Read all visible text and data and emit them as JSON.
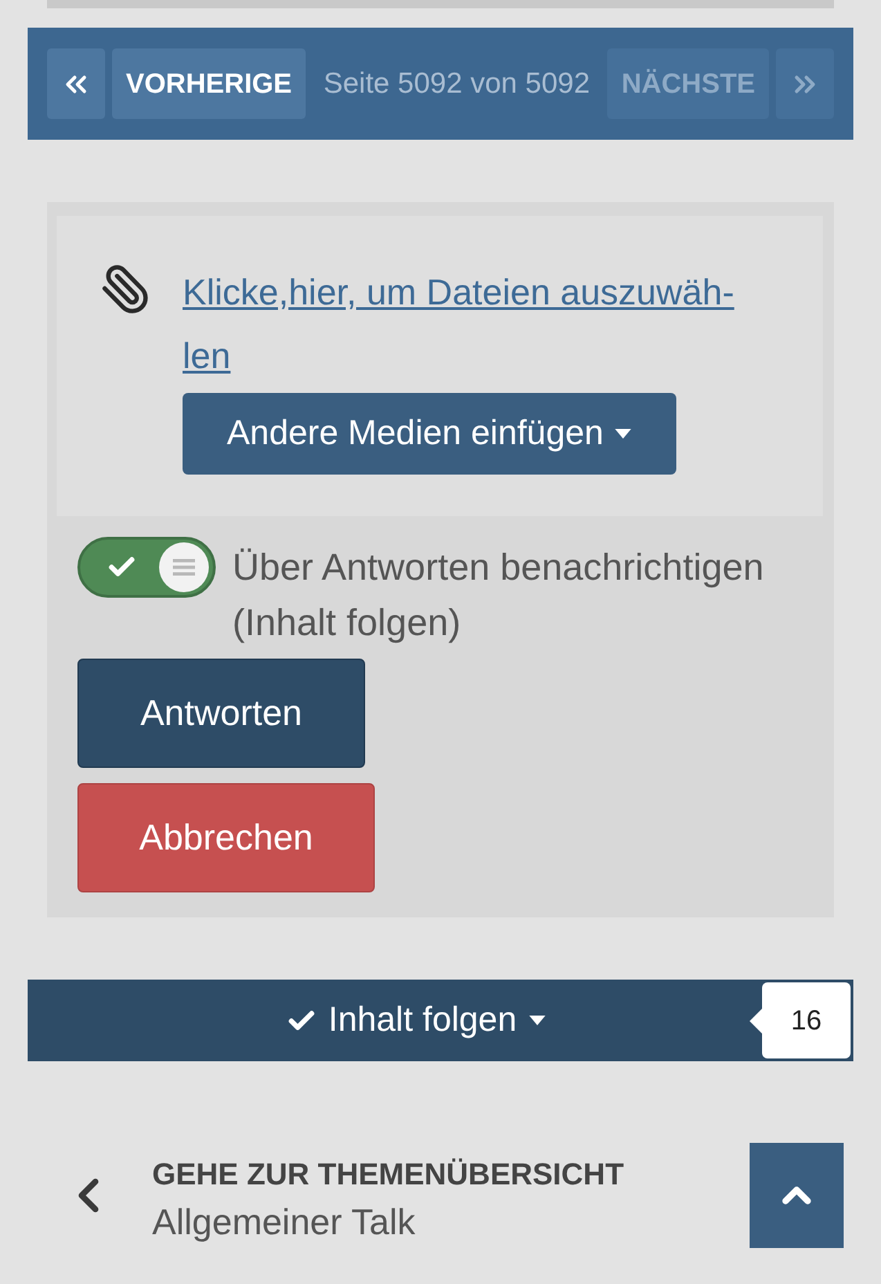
{
  "pagination": {
    "first": {
      "disabled": false
    },
    "previous": {
      "label": "VORHERIGE",
      "disabled": false
    },
    "page_info": "Seite 5092 von 5092",
    "next": {
      "label": "NÄCHSTE",
      "disabled": true
    },
    "last": {
      "disabled": true
    }
  },
  "attachments": {
    "link": "Klicke,hier, um Dateien auszuwäh-len",
    "media_button": "Andere Medien einfügen"
  },
  "notify": {
    "on": true,
    "label": "Über Antworten benachrichtigen (Inhalt folgen)"
  },
  "buttons": [
    {
      "kind": "primary",
      "label": "Antworten"
    },
    {
      "kind": "danger",
      "label": "Abbrechen"
    }
  ],
  "follow": {
    "label": "Inhalt folgen",
    "following": true,
    "count": "16"
  },
  "topic_nav": {
    "heading": "GEHE ZUR THEMENÜBERSICHT",
    "forum": "Allgemeiner Talk"
  }
}
